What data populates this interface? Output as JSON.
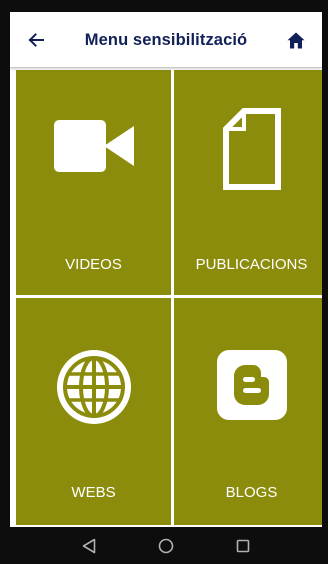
{
  "header": {
    "title": "Menu sensibilització",
    "back_icon": "arrow-left-icon",
    "home_icon": "home-icon"
  },
  "tiles": [
    {
      "label": "VIDEOS",
      "icon": "video-camera-icon"
    },
    {
      "label": "PUBLICACIONS",
      "icon": "document-icon"
    },
    {
      "label": "WEBS",
      "icon": "globe-icon"
    },
    {
      "label": "BLOGS",
      "icon": "blogger-icon"
    }
  ],
  "navbar": {
    "back": "triangle-back-icon",
    "home": "circle-home-icon",
    "recents": "square-recents-icon"
  },
  "colors": {
    "tile": "#8c8c0c",
    "title": "#12205a",
    "frame": "#0d0d0d",
    "navbar_icons": "#b0b0b0"
  }
}
